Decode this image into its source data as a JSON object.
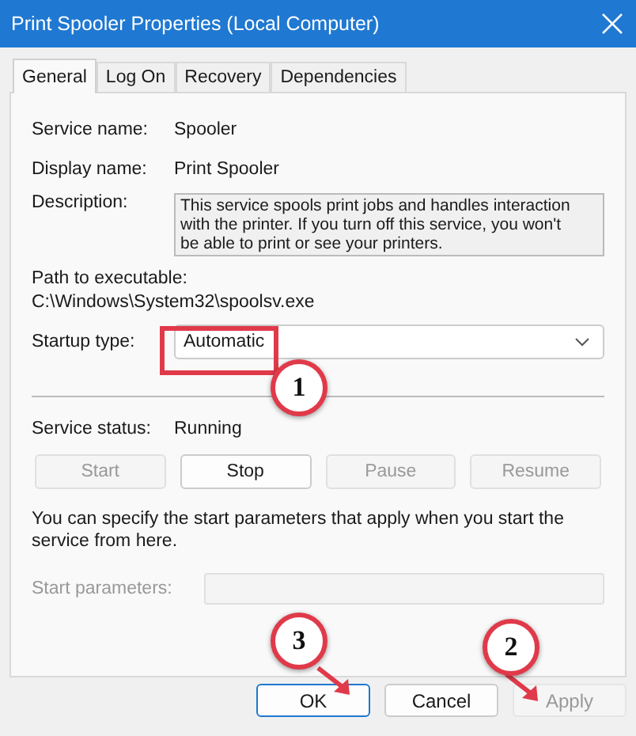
{
  "window": {
    "title": "Print Spooler Properties (Local Computer)"
  },
  "tabs": [
    {
      "label": "General",
      "selected": true
    },
    {
      "label": "Log On",
      "selected": false
    },
    {
      "label": "Recovery",
      "selected": false
    },
    {
      "label": "Dependencies",
      "selected": false
    }
  ],
  "info": [
    {
      "label": "Service name:",
      "value": "Spooler"
    },
    {
      "label": "Display name:",
      "value": "Print Spooler"
    }
  ],
  "description": {
    "label": "Description:",
    "lines": [
      "This service spools print jobs and handles interaction",
      "with the printer.  If you turn off this service, you won't",
      "be able to print or see your printers."
    ]
  },
  "path": {
    "label": "Path to executable:",
    "value": "C:\\Windows\\System32\\spoolsv.exe"
  },
  "startup_type": {
    "label": "Startup type:",
    "value": "Automatic"
  },
  "service_status": {
    "label": "Service status:",
    "value": "Running"
  },
  "service_buttons": [
    {
      "label": "Start",
      "disabled": true
    },
    {
      "label": "Stop",
      "disabled": false
    },
    {
      "label": "Pause",
      "disabled": true
    },
    {
      "label": "Resume",
      "disabled": true
    }
  ],
  "hint": "You can specify the start parameters that apply when you start the service from here.",
  "start_parameters": {
    "label": "Start parameters:",
    "disabled": true
  },
  "dialog_buttons": [
    {
      "label": "OK",
      "default": true,
      "disabled": false
    },
    {
      "label": "Cancel",
      "default": false,
      "disabled": false
    },
    {
      "label": "Apply",
      "default": false,
      "disabled": true
    }
  ],
  "callouts": [
    {
      "number": "1",
      "kind": "box"
    },
    {
      "number": "3",
      "kind": "arrow"
    },
    {
      "number": "2",
      "kind": "arrow"
    }
  ]
}
